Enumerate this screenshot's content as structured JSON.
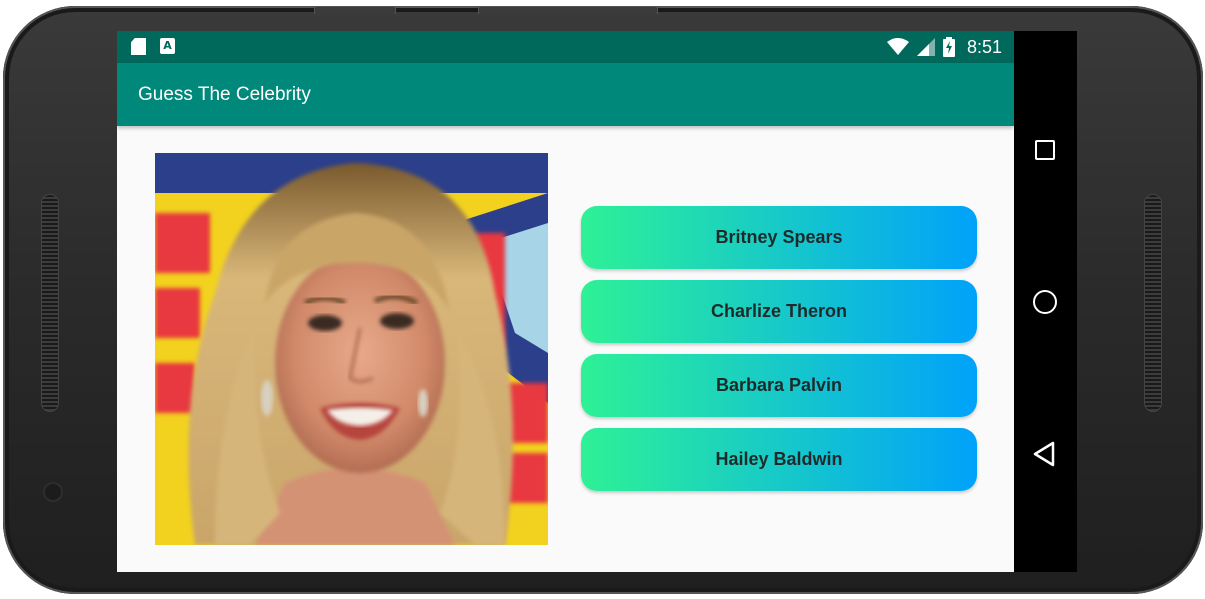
{
  "status_bar": {
    "time": "8:51",
    "left_icons": [
      "sd-card-icon",
      "a-notification-icon"
    ],
    "right_icons": [
      "wifi-icon",
      "cell-signal-icon",
      "battery-charging-icon"
    ],
    "a_glyph": "A",
    "color": "#00695c"
  },
  "toolbar": {
    "title": "Guess The Celebrity",
    "color": "#00897b"
  },
  "main": {
    "photo_icon": "celebrity-photo",
    "answers": [
      {
        "label": "Britney Spears"
      },
      {
        "label": "Charlize Theron"
      },
      {
        "label": "Barbara Palvin"
      },
      {
        "label": "Hailey Baldwin"
      }
    ],
    "button_gradient": [
      "#2ef196",
      "#00a2fa"
    ]
  },
  "nav_bar": {
    "icons": [
      "recents-square-icon",
      "home-circle-icon",
      "back-triangle-icon"
    ]
  }
}
